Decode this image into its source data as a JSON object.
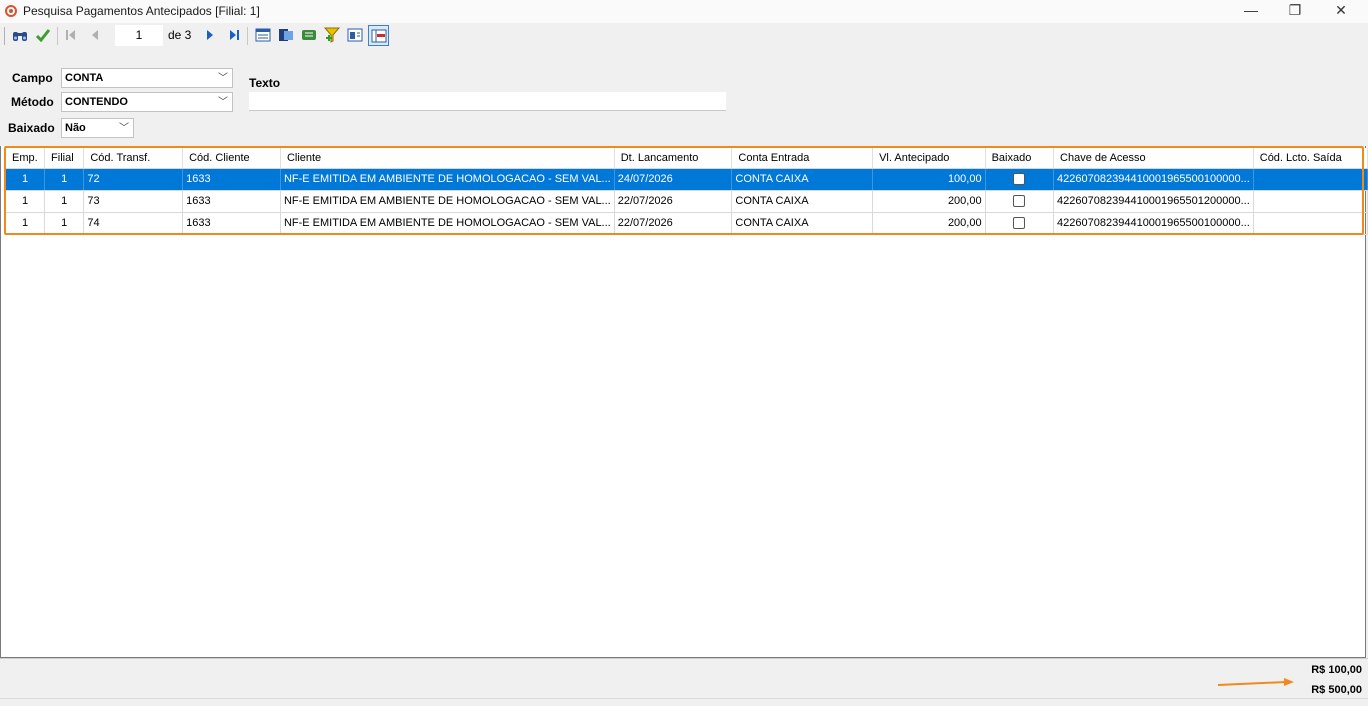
{
  "window": {
    "title": "Pesquisa Pagamentos Antecipados [Filial: 1]",
    "minimize": "—",
    "maximize": "❐",
    "close": "✕"
  },
  "toolbar": {
    "page_current": "1",
    "page_total_label": "de 3"
  },
  "filters": {
    "campo_label": "Campo",
    "campo_value": "CONTA",
    "metodo_label": "Método",
    "metodo_value": "CONTENDO",
    "baixado_label": "Baixado",
    "baixado_value": "Não",
    "texto_label": "Texto",
    "texto_value": ""
  },
  "grid": {
    "columns": [
      "Emp.",
      "Filial",
      "Cód. Transf.",
      "Cód. Cliente",
      "Cliente",
      "Dt. Lancamento",
      "Conta Entrada",
      "Vl. Antecipado",
      "Baixado",
      "Chave de Acesso",
      "Cód. Lcto. Saída"
    ],
    "rows": [
      {
        "emp": "1",
        "filial": "1",
        "cod_transf": "72",
        "cod_cliente": "1633",
        "cliente": "NF-E EMITIDA EM AMBIENTE DE HOMOLOGACAO - SEM VAL...",
        "dt_lancamento": "24/07/2026",
        "conta_entrada": "CONTA CAIXA",
        "vl_antecipado": "100,00",
        "baixado": false,
        "chave_acesso": "422607082394410001965500100000...",
        "cod_lcto_saida": ""
      },
      {
        "emp": "1",
        "filial": "1",
        "cod_transf": "73",
        "cod_cliente": "1633",
        "cliente": "NF-E EMITIDA EM AMBIENTE DE HOMOLOGACAO - SEM VAL...",
        "dt_lancamento": "22/07/2026",
        "conta_entrada": "CONTA CAIXA",
        "vl_antecipado": "200,00",
        "baixado": false,
        "chave_acesso": "422607082394410001965501200000...",
        "cod_lcto_saida": ""
      },
      {
        "emp": "1",
        "filial": "1",
        "cod_transf": "74",
        "cod_cliente": "1633",
        "cliente": "NF-E EMITIDA EM AMBIENTE DE HOMOLOGACAO - SEM VAL...",
        "dt_lancamento": "22/07/2026",
        "conta_entrada": "CONTA CAIXA",
        "vl_antecipado": "200,00",
        "baixado": false,
        "chave_acesso": "422607082394410001965500100000...",
        "cod_lcto_saida": ""
      }
    ],
    "selected_row": 0
  },
  "totals": {
    "line1": "R$ 100,00",
    "line2": "R$ 500,00"
  },
  "colors": {
    "selection": "#0078d7",
    "highlight": "#f08a1c"
  }
}
